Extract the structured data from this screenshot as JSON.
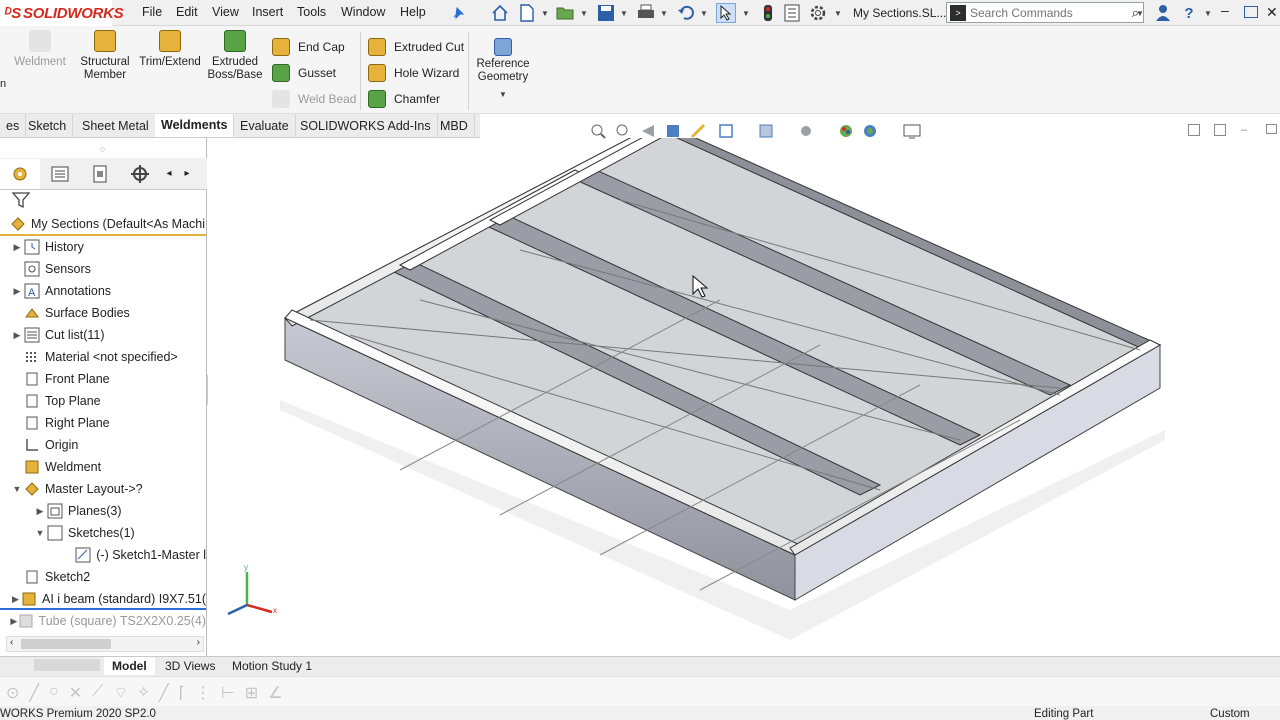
{
  "app": {
    "brand": "SOLIDWORKS",
    "document": "My Sections.SL...",
    "search_placeholder": "Search Commands"
  },
  "menus": [
    "File",
    "Edit",
    "View",
    "Insert",
    "Tools",
    "Window",
    "Help"
  ],
  "ribbon": {
    "weldment": "Weldment",
    "structural_member": "Structural Member",
    "trim_extend": "Trim/Extend",
    "extruded_boss": "Extruded Boss/Base",
    "end_cap": "End Cap",
    "gusset": "Gusset",
    "weld_bead": "Weld Bead",
    "extruded_cut": "Extruded Cut",
    "hole_wizard": "Hole Wizard",
    "chamfer": "Chamfer",
    "reference_geometry": "Reference Geometry"
  },
  "tabs": [
    "es",
    "Sketch",
    "Sheet Metal",
    "Weldments",
    "Evaluate",
    "SOLIDWORKS Add-Ins",
    "MBD"
  ],
  "active_tab": "Weldments",
  "tree": {
    "root": "My Sections  (Default<As Machi",
    "items": [
      "History",
      "Sensors",
      "Annotations",
      "Surface Bodies",
      "Cut list(11)",
      "Material <not specified>",
      "Front Plane",
      "Top Plane",
      "Right Plane",
      "Origin",
      "Weldment",
      "Master Layout->?",
      "Planes(3)",
      "Sketches(1)",
      "(-) Sketch1-Master l",
      "Sketch2",
      "AI i beam (standard) I9X7.51(",
      "Tube (square) TS2X2X0.25(4)"
    ]
  },
  "bottom_tabs": [
    "Model",
    "3D Views",
    "Motion Study 1"
  ],
  "status": {
    "left": "WORKS Premium 2020 SP2.0",
    "mode": "Editing Part",
    "units": "Custom"
  },
  "colors": {
    "brand_red": "#d52b1e",
    "accent_blue": "#2a6fd6"
  }
}
